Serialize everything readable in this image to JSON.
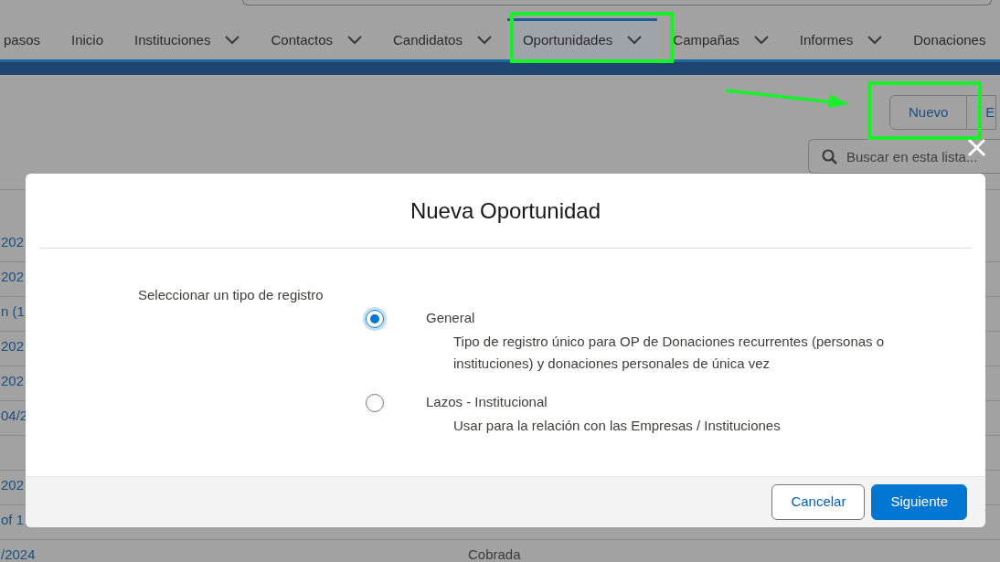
{
  "nav": [
    {
      "label": "pasos",
      "dropdown": false,
      "selected": false
    },
    {
      "label": "Inicio",
      "dropdown": false,
      "selected": false
    },
    {
      "label": "Instituciones",
      "dropdown": true,
      "selected": false
    },
    {
      "label": "Contactos",
      "dropdown": true,
      "selected": false
    },
    {
      "label": "Candidatos",
      "dropdown": true,
      "selected": false
    },
    {
      "label": "Oportunidades",
      "dropdown": true,
      "selected": true
    },
    {
      "label": "Campañas",
      "dropdown": true,
      "selected": false
    },
    {
      "label": "Informes",
      "dropdown": true,
      "selected": false
    },
    {
      "label": "Donaciones",
      "dropdown": false,
      "selected": false
    }
  ],
  "actions": [
    "Nuevo",
    "E"
  ],
  "list_search": {
    "placeholder": "Buscar en esta lista..."
  },
  "table": {
    "rows": [
      {
        "column_1": "202"
      },
      {
        "column_1": "202"
      },
      {
        "column_1": "n (1"
      },
      {
        "column_1": "202"
      },
      {
        "column_1": "202"
      },
      {
        "column_1": "04/2"
      },
      {},
      {
        "column_1": "202"
      },
      {
        "column_1": "of 1"
      },
      {
        "column_1": "/2024",
        "column_2": "Cobrada"
      }
    ]
  },
  "modal": {
    "title": "Nueva Oportunidad",
    "label": "Seleccionar un tipo de registro",
    "options": [
      {
        "name": "General",
        "description": "Tipo de registro único para OP de Donaciones recurrentes (personas o instituciones) y donaciones personales de única vez",
        "selected": true
      },
      {
        "name": "Lazos - Institucional",
        "description": "Usar para la relación con las Empresas / Instituciones",
        "selected": false
      }
    ],
    "buttons": [
      {
        "label": "Cancelar",
        "kind": "neutral"
      },
      {
        "label": "Siguiente",
        "kind": "brand"
      }
    ]
  }
}
